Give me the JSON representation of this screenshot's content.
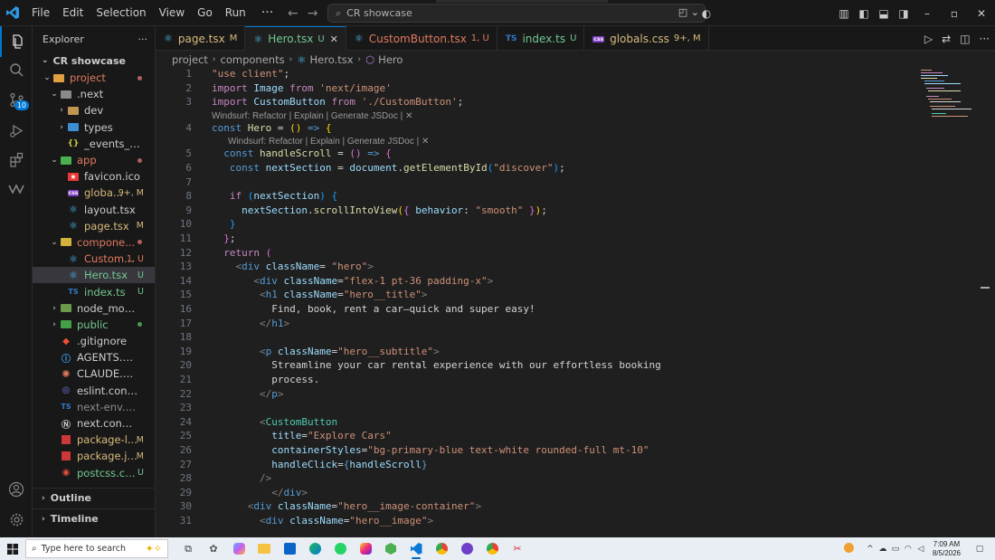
{
  "titlebar": {
    "menus": [
      "File",
      "Edit",
      "Selection",
      "View",
      "Go",
      "Run"
    ],
    "more": "···",
    "search_text": "CR showcase"
  },
  "activity": {
    "source_control_badge": "10"
  },
  "sidebar": {
    "title": "Explorer",
    "more": "···",
    "root": "CR showcase",
    "tree": [
      {
        "name": "project",
        "kind": "folder-open",
        "indent": 1,
        "status": "",
        "dot": "#b35f5f",
        "color": "#e07a5f"
      },
      {
        "name": ".next",
        "kind": "folder-open-gear",
        "indent": 2,
        "status": "",
        "dot": "",
        "color": "#cccccc"
      },
      {
        "name": "dev",
        "kind": "folder",
        "indent": 3,
        "status": "",
        "dot": "",
        "color": "#cccccc"
      },
      {
        "name": "types",
        "kind": "folder-ts",
        "indent": 3,
        "status": "",
        "dot": "",
        "color": "#cccccc"
      },
      {
        "name": "_events_960...",
        "kind": "json",
        "indent": 3,
        "status": "",
        "dot": "",
        "color": "#cccccc"
      },
      {
        "name": "app",
        "kind": "folder-open-app",
        "indent": 2,
        "status": "",
        "dot": "#b35f5f",
        "color": "#e07a5f"
      },
      {
        "name": "favicon.ico",
        "kind": "star",
        "indent": 3,
        "status": "",
        "dot": "",
        "color": "#cccccc"
      },
      {
        "name": "globa...",
        "kind": "css",
        "indent": 3,
        "status": "9+, M",
        "dot": "",
        "color": "#d7ba7d"
      },
      {
        "name": "layout.tsx",
        "kind": "react",
        "indent": 3,
        "status": "",
        "dot": "",
        "color": "#cccccc"
      },
      {
        "name": "page.tsx",
        "kind": "react",
        "indent": 3,
        "status": "M",
        "dot": "",
        "color": "#d7ba7d"
      },
      {
        "name": "compone...",
        "kind": "folder-open-comp",
        "indent": 2,
        "status": "",
        "dot": "#b35f5f",
        "color": "#e07a5f"
      },
      {
        "name": "Custom...",
        "kind": "react",
        "indent": 3,
        "status": "1, U",
        "dot": "",
        "color": "#e07a5f"
      },
      {
        "name": "Hero.tsx",
        "kind": "react",
        "indent": 3,
        "status": "U",
        "dot": "",
        "color": "#73c991",
        "selected": true
      },
      {
        "name": "index.ts",
        "kind": "ts",
        "indent": 3,
        "status": "U",
        "dot": "",
        "color": "#73c991"
      },
      {
        "name": "node_modules",
        "kind": "folder-node",
        "indent": 2,
        "status": "",
        "dot": "",
        "color": "#cccccc"
      },
      {
        "name": "public",
        "kind": "folder-public",
        "indent": 2,
        "status": "",
        "dot": "#4e9a4e",
        "color": "#73c991"
      },
      {
        "name": ".gitignore",
        "kind": "git",
        "indent": 2,
        "status": "",
        "dot": "",
        "color": "#cccccc"
      },
      {
        "name": "AGENTS.md",
        "kind": "md",
        "indent": 2,
        "status": "",
        "dot": "",
        "color": "#cccccc"
      },
      {
        "name": "CLAUDE.md",
        "kind": "claude",
        "indent": 2,
        "status": "",
        "dot": "",
        "color": "#cccccc"
      },
      {
        "name": "eslint.config.mjs",
        "kind": "eslint",
        "indent": 2,
        "status": "",
        "dot": "",
        "color": "#cccccc"
      },
      {
        "name": "next-env.d.ts",
        "kind": "ts",
        "indent": 2,
        "status": "",
        "dot": "",
        "color": "#8b8b8b"
      },
      {
        "name": "next.config.ts",
        "kind": "next",
        "indent": 2,
        "status": "",
        "dot": "",
        "color": "#cccccc"
      },
      {
        "name": "package-l...",
        "kind": "npm",
        "indent": 2,
        "status": "M",
        "dot": "",
        "color": "#d7ba7d"
      },
      {
        "name": "package.js...",
        "kind": "npm",
        "indent": 2,
        "status": "M",
        "dot": "",
        "color": "#d7ba7d"
      },
      {
        "name": "postcss.co...",
        "kind": "postcss",
        "indent": 2,
        "status": "U",
        "dot": "",
        "color": "#73c991"
      }
    ],
    "outline": "Outline",
    "timeline": "Timeline"
  },
  "tabs": [
    {
      "label": "page.tsx",
      "icon": "react",
      "status": "M",
      "color": "#d7ba7d",
      "active": false
    },
    {
      "label": "Hero.tsx",
      "icon": "react",
      "status": "U",
      "color": "#73c991",
      "active": true
    },
    {
      "label": "CustomButton.tsx",
      "icon": "react",
      "status": "1, U",
      "color": "#e07a5f",
      "active": false
    },
    {
      "label": "index.ts",
      "icon": "ts",
      "status": "U",
      "color": "#73c991",
      "active": false
    },
    {
      "label": "globals.css",
      "icon": "css",
      "status": "9+, M",
      "color": "#d7ba7d",
      "active": false
    }
  ],
  "breadcrumb": [
    "project",
    "components",
    "Hero.tsx",
    "Hero"
  ],
  "codelens": {
    "line4": "Windsurf: Refactor | Explain | Generate JSDoc | ✕",
    "line5": "Windsurf: Refactor | Explain | Generate JSDoc | ✕"
  },
  "code_lines": [
    {
      "n": "1",
      "html": "<span class=\"s\">\"use client\"</span>;"
    },
    {
      "n": "2",
      "html": "<span class=\"k\">import</span> <span class=\"v\">Image</span> <span class=\"k\">from</span> <span class=\"s\">'next/image'</span>"
    },
    {
      "n": "3",
      "html": "<span class=\"k\">import</span> <span class=\"v\">CustomButton</span> <span class=\"k\">from</span> <span class=\"s\">'./CustomButton'</span>;"
    },
    {
      "n": "4",
      "html": "<span class=\"kb\">const</span> <span class=\"f\">Hero</span> = <span class=\"y\">()</span> <span class=\"kb\">=&gt;</span> <span class=\"y\">{</span>"
    },
    {
      "n": "5",
      "html": "  <span class=\"kb\">const</span> <span class=\"f\">handleScroll</span> = <span class=\"p\">()</span> <span class=\"kb\">=&gt;</span> <span class=\"p\">{</span>"
    },
    {
      "n": "6",
      "html": "   <span class=\"kb\">const</span> <span class=\"v\">nextSection</span> = <span class=\"v\">document</span>.<span class=\"f\">getElementById</span><span class=\"b\">(</span><span class=\"s\">\"discover\"</span><span class=\"b\">)</span>;"
    },
    {
      "n": "7",
      "html": ""
    },
    {
      "n": "8",
      "html": "   <span class=\"k\">if</span> <span class=\"b\">(</span><span class=\"v\">nextSection</span><span class=\"b\">)</span> <span class=\"b\">{</span>"
    },
    {
      "n": "9",
      "html": "     <span class=\"v\">nextSection</span>.<span class=\"f\">scrollIntoView</span><span class=\"y\">(</span><span class=\"p\">{</span> <span class=\"v\">behavior</span>: <span class=\"s\">\"smooth\"</span> <span class=\"p\">}</span><span class=\"y\">)</span>;"
    },
    {
      "n": "10",
      "html": "   <span class=\"b\">}</span>"
    },
    {
      "n": "11",
      "html": "  <span class=\"p\">}</span>;"
    },
    {
      "n": "12",
      "html": "  <span class=\"k\">return</span> <span class=\"p\">(</span>"
    },
    {
      "n": "13",
      "html": "    <span class=\"g\">&lt;</span><span class=\"kb\">div</span> <span class=\"v\">className</span>= <span class=\"s\">\"hero\"</span><span class=\"g\">&gt;</span>"
    },
    {
      "n": "14",
      "html": "       <span class=\"g\">&lt;</span><span class=\"kb\">div</span> <span class=\"v\">className</span>=<span class=\"s\">\"flex-1 pt-36 padding-x\"</span><span class=\"g\">&gt;</span>"
    },
    {
      "n": "15",
      "html": "        <span class=\"g\">&lt;</span><span class=\"kb\">h1</span> <span class=\"v\">className</span>=<span class=\"s\">\"hero__title\"</span><span class=\"g\">&gt;</span>"
    },
    {
      "n": "16",
      "html": "          Find, book, rent a car—quick and super easy!"
    },
    {
      "n": "17",
      "html": "        <span class=\"g\">&lt;/</span><span class=\"kb\">h1</span><span class=\"g\">&gt;</span>"
    },
    {
      "n": "18",
      "html": ""
    },
    {
      "n": "19",
      "html": "        <span class=\"g\">&lt;</span><span class=\"kb\">p</span> <span class=\"v\">className</span>=<span class=\"s\">\"hero__subtitle\"</span><span class=\"g\">&gt;</span>"
    },
    {
      "n": "20",
      "html": "          Streamline your car rental experience with our effortless booking"
    },
    {
      "n": "21",
      "html": "          process."
    },
    {
      "n": "22",
      "html": "        <span class=\"g\">&lt;/</span><span class=\"kb\">p</span><span class=\"g\">&gt;</span>"
    },
    {
      "n": "23",
      "html": ""
    },
    {
      "n": "24",
      "html": "        <span class=\"g\">&lt;</span><span class=\"t\">CustomButton</span>"
    },
    {
      "n": "25",
      "html": "          <span class=\"v\">title</span>=<span class=\"s\">\"Explore Cars\"</span>"
    },
    {
      "n": "26",
      "html": "          <span class=\"v\">containerStyles</span>=<span class=\"s\">\"bg-primary-blue text-white rounded-full mt-10\"</span>"
    },
    {
      "n": "27",
      "html": "          <span class=\"v\">handleClick</span>=<span class=\"kb\">{</span><span class=\"v\">handleScroll</span><span class=\"kb\">}</span>"
    },
    {
      "n": "28",
      "html": "        <span class=\"g\">/&gt;</span>"
    },
    {
      "n": "29",
      "html": "          <span class=\"g\">&lt;/</span><span class=\"kb\">div</span><span class=\"g\">&gt;</span>"
    },
    {
      "n": "30",
      "html": "      <span class=\"g\">&lt;</span><span class=\"kb\">div</span> <span class=\"v\">className</span>=<span class=\"s\">\"hero__image-container\"</span><span class=\"g\">&gt;</span>"
    },
    {
      "n": "31",
      "html": "        <span class=\"g\">&lt;</span><span class=\"kb\">div</span> <span class=\"v\">className</span>=<span class=\"s\">\"hero__image\"</span><span class=\"g\">&gt;</span>"
    }
  ],
  "taskbar": {
    "search_placeholder": "Type here to search",
    "time": "7:09 AM",
    "date": "8/5/2026"
  },
  "colors": {
    "accent": "#0078d4",
    "modified": "#d7ba7d",
    "untracked": "#73c991",
    "error": "#e07a5f"
  }
}
